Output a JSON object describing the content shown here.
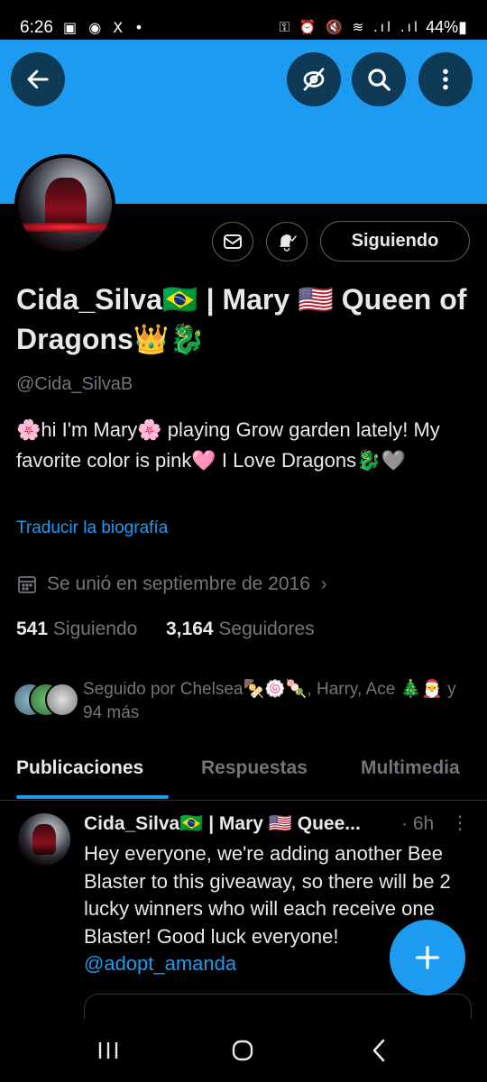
{
  "status_bar": {
    "time": "6:26",
    "left_icons": "▣ ◉ X •",
    "right_icons": "⚿ ⏰ 🔇 ≋ .ıl .ıl",
    "battery": "44%"
  },
  "colors": {
    "accent": "#1d9bf0",
    "background": "#000000",
    "text_primary": "#e7e9ea",
    "text_secondary": "#71767b",
    "banner": "#1d9bf0"
  },
  "header": {
    "back_icon": "arrow-left-icon",
    "hide_icon": "eye-off-icon",
    "search_icon": "search-icon",
    "more_icon": "more-vertical-icon"
  },
  "profile": {
    "follow_button_label": "Siguiendo",
    "name": "Cida_Silva🇧🇷 | Mary 🇺🇸 Queen of Dragons👑🐉",
    "handle": "@Cida_SilvaB",
    "bio": "🌸hi I'm Mary🌸   playing Grow garden lately! My favorite color is pink🩷 I Love Dragons🐉🩶",
    "translate_link": "Traducir la biografía",
    "joined": "Se unió en septiembre de 2016",
    "following_count": "541",
    "following_label": "Siguiendo",
    "followers_count": "3,164",
    "followers_label": "Seguidores",
    "followed_by": "Seguido por Chelsea🍢🍥🍡, Harry, Ace 🎄🎅 y 94 más"
  },
  "tabs": [
    {
      "label": "Publicaciones"
    },
    {
      "label": "Respuestas"
    },
    {
      "label": "Multimedia"
    }
  ],
  "post": {
    "author": "Cida_Silva🇧🇷 | Mary 🇺🇸 Quee...",
    "time": "· 6h",
    "more": "⋮",
    "text": "Hey everyone, we're adding another Bee Blaster to this giveaway, so there will be 2 lucky winners who will each receive one Blaster! Good luck everyone! ",
    "mention": "@adopt_amanda"
  }
}
